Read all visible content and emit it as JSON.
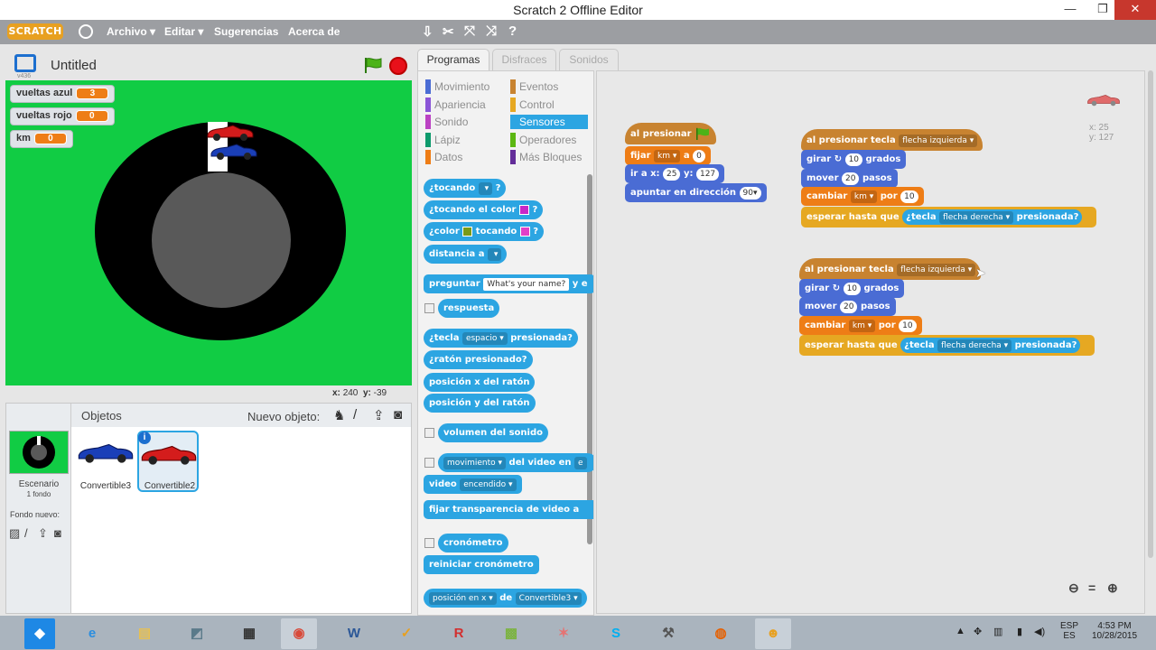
{
  "window": {
    "title": "Scratch 2 Offline Editor",
    "min": "—",
    "max": "❐",
    "close": "✕"
  },
  "menu": {
    "logo": "SCRATCH",
    "items": [
      "Archivo ▾",
      "Editar ▾",
      "Sugerencias",
      "Acerca de"
    ]
  },
  "stage": {
    "version": "v436",
    "title": "Untitled",
    "monitors": [
      {
        "label": "vueltas azul",
        "value": "3"
      },
      {
        "label": "vueltas rojo",
        "value": "0"
      },
      {
        "label": "km",
        "value": "0"
      }
    ],
    "coords": {
      "x_label": "x:",
      "x": "240",
      "y_label": "y:",
      "y": "-39"
    }
  },
  "sprites": {
    "objetos": "Objetos",
    "nuevo_objeto": "Nuevo objeto:",
    "stage_label": "Escenario",
    "stage_sub": "1 fondo",
    "fondo_nuevo": "Fondo nuevo:",
    "list": [
      {
        "name": "Convertible3"
      },
      {
        "name": "Convertible2"
      }
    ]
  },
  "tabs": [
    "Programas",
    "Disfraces",
    "Sonidos"
  ],
  "categories": [
    {
      "label": "Movimiento",
      "color": "#4a6cd4"
    },
    {
      "label": "Eventos",
      "color": "#c88330"
    },
    {
      "label": "Apariencia",
      "color": "#8a55d7"
    },
    {
      "label": "Control",
      "color": "#e6a822"
    },
    {
      "label": "Sonido",
      "color": "#bb42c3"
    },
    {
      "label": "Sensores",
      "color": "#2ca5e2"
    },
    {
      "label": "Lápiz",
      "color": "#0e9a6c"
    },
    {
      "label": "Operadores",
      "color": "#5cb712"
    },
    {
      "label": "Datos",
      "color": "#ee7d16"
    },
    {
      "label": "Más Bloques",
      "color": "#632d99"
    }
  ],
  "palette": {
    "tocando": "¿tocando",
    "tocando_q": "?",
    "tocando_color": "¿tocando el color",
    "color": "¿color",
    "color_tocando": "tocando",
    "distancia": "distancia a",
    "preguntar": "preguntar",
    "preguntar_input": "What's your name?",
    "preguntar_tail": "y e",
    "respuesta": "respuesta",
    "tecla": "¿tecla",
    "tecla_dd": "espacio",
    "tecla_tail": "presionada?",
    "raton_presionado": "¿ratón presionado?",
    "pos_x": "posición x del ratón",
    "pos_y": "posición y del ratón",
    "volumen": "volumen del sonido",
    "movimiento_dd": "movimiento",
    "video_en": "del video en",
    "video": "video",
    "video_dd": "encendido",
    "transparencia": "fijar transparencia de video a",
    "cronometro": "cronómetro",
    "reiniciar": "reiniciar cronómetro",
    "posicion_dd": "posición en x",
    "de": "de",
    "de_dd": "Convertible3"
  },
  "script1": {
    "hat": "al presionar",
    "fijar": "fijar",
    "fijar_dd": "km",
    "fijar_a": "a",
    "fijar_val": "0",
    "ir": "ir a x:",
    "ir_x": "25",
    "ir_y_label": "y:",
    "ir_y": "127",
    "apuntar": "apuntar en dirección",
    "apuntar_val": "90▾"
  },
  "script2": {
    "hat": "al presionar tecla",
    "hat_dd": "flecha izquierda",
    "girar": "girar",
    "girar_val": "10",
    "grados": "grados",
    "mover": "mover",
    "mover_val": "20",
    "pasos": "pasos",
    "cambiar": "cambiar",
    "cambiar_dd": "km",
    "por": "por",
    "cambiar_val": "10",
    "esperar": "esperar hasta que",
    "tecla": "¿tecla",
    "tecla_dd": "flecha derecha",
    "presionada": "presionada?"
  },
  "sprite_info": {
    "x": "x: 25",
    "y": "y: 127"
  },
  "taskbar": {
    "lang_top": "ESP",
    "lang_bottom": "ES",
    "time": "4:53 PM",
    "date": "10/28/2015"
  }
}
